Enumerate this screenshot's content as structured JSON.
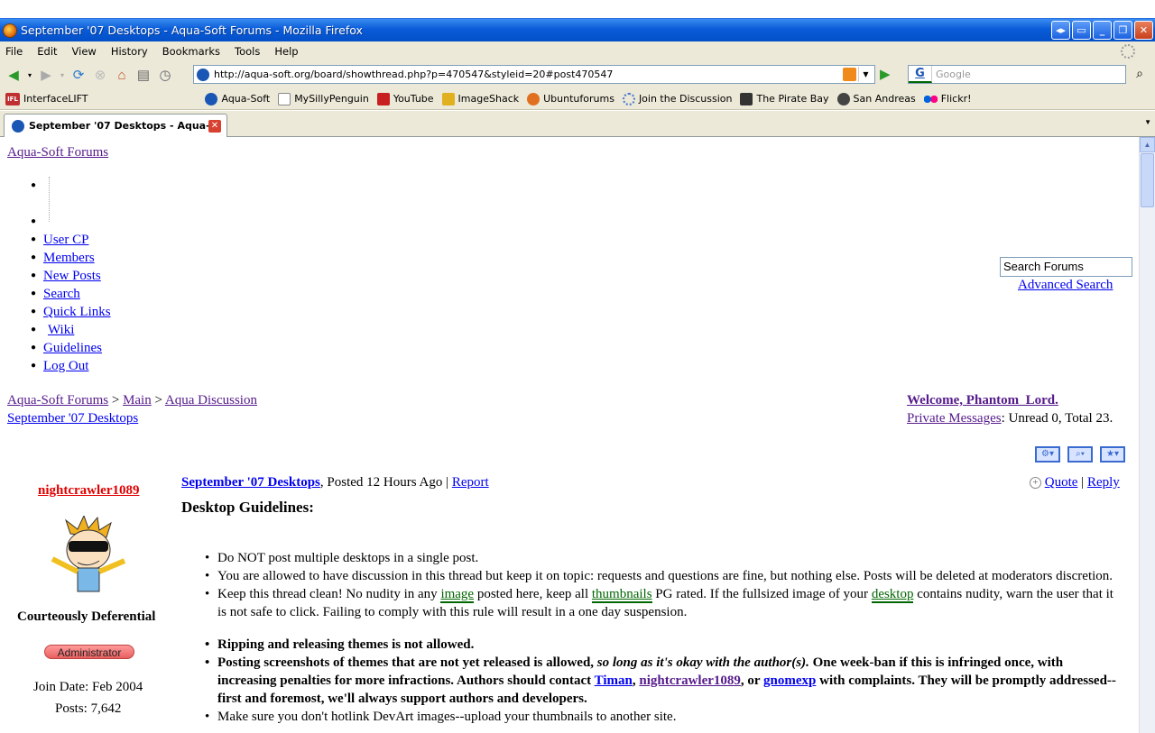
{
  "window": {
    "title": "September '07 Desktops - Aqua-Soft Forums - Mozilla Firefox"
  },
  "menu": [
    "File",
    "Edit",
    "View",
    "History",
    "Bookmarks",
    "Tools",
    "Help"
  ],
  "address": {
    "url": "http://aqua-soft.org/board/showthread.php?p=470547&styleid=20#post470547"
  },
  "search_engine": {
    "placeholder": "Google"
  },
  "bookmarks": [
    {
      "label": "InterfaceLIFT",
      "icon": "ifl-icon"
    },
    {
      "label": "Aqua-Soft",
      "icon": "aquasoft-icon"
    },
    {
      "label": "MySillyPenguin",
      "icon": "page-icon"
    },
    {
      "label": "YouTube",
      "icon": "youtube-icon"
    },
    {
      "label": "ImageShack",
      "icon": "imageshack-icon"
    },
    {
      "label": "Ubuntuforums",
      "icon": "ubuntu-icon"
    },
    {
      "label": "Join the Discussion",
      "icon": "gear-icon"
    },
    {
      "label": "The Pirate Bay",
      "icon": "ship-icon"
    },
    {
      "label": "San Andreas",
      "icon": "gta-icon"
    },
    {
      "label": "Flickr!",
      "icon": "flickr-icon"
    }
  ],
  "tab": {
    "title": "September '07 Desktops - Aqua-..."
  },
  "page": {
    "site_link": "Aqua-Soft Forums",
    "nav": [
      "User CP",
      "Members",
      "New Posts",
      "Search",
      "Quick Links",
      "Wiki",
      "Guidelines",
      "Log Out"
    ],
    "search_value": "Search Forums",
    "advanced_search": "Advanced Search",
    "breadcrumb": {
      "a": "Aqua-Soft Forums",
      "sep1": " > ",
      "b": "Main",
      "sep2": " > ",
      "c": "Aqua Discussion",
      "thread": "September '07 Desktops"
    },
    "welcome": "Welcome, Phantom_Lord.",
    "pm_link": "Private Messages",
    "pm_text": ": Unread 0, Total 23.",
    "user": {
      "name": "nightcrawler1089",
      "title": "Courteously Deferential",
      "badge": "Administrator",
      "join": "Join Date: Feb 2004",
      "posts": "Posts: 7,642"
    },
    "post": {
      "thread_link": "September '07 Desktops",
      "posted": ", Posted 12 Hours Ago | ",
      "report": "Report",
      "quote": "Quote",
      "sep": " | ",
      "reply": "Reply",
      "heading": "Desktop Guidelines:",
      "r1": "Do NOT post multiple desktops in a single post.",
      "r2": "You are allowed to have discussion in this thread but keep it on topic: requests and questions are fine, but nothing else. Posts will be deleted at moderators discretion.",
      "r3a": "Keep this thread clean! No nudity in any ",
      "r3b": "image",
      "r3c": " posted here, keep all ",
      "r3d": "thumbnails",
      "r3e": " PG rated. If the fullsized image of your ",
      "r3f": "desktop",
      "r3g": " contains nudity, warn the user that it is not safe to click. Failing to comply with this rule will result in a one day suspension.",
      "r4": "Ripping and releasing themes is not allowed.",
      "r5a": "Posting screenshots of themes that are not yet released is allowed, ",
      "r5b": "so long as it's okay with the author(s).",
      "r5c": " One week-ban if this is infringed once, with increasing penalties for more infractions. Authors should contact ",
      "r5d": "Timan",
      "r5e": ", ",
      "r5f": "nightcrawler1089",
      "r5g": ", or ",
      "r5h": "gnomexp",
      "r5i": " with complaints. They will be promptly addressed--first and foremost, we'll always support authors and developers.",
      "r6": "Make sure you don't hotlink DevArt images--upload your thumbnails to another site."
    }
  }
}
